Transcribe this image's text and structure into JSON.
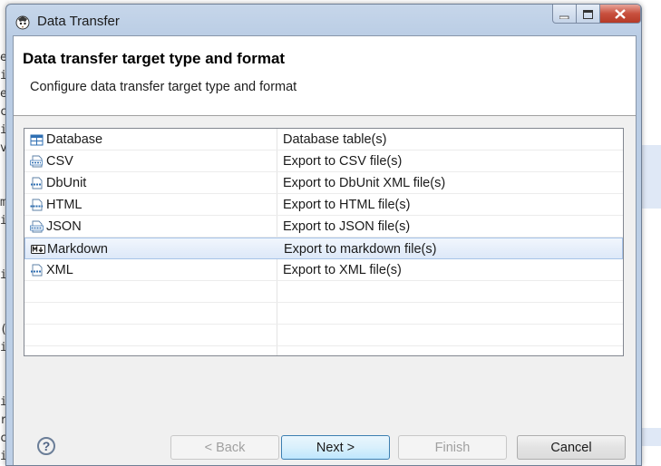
{
  "window": {
    "title": "Data Transfer"
  },
  "header": {
    "title": "Data transfer target type and format",
    "subtitle": "Configure data transfer target type and format"
  },
  "table": {
    "rows": [
      {
        "name": "Database",
        "description": "Database table(s)",
        "icon": "database-table-icon",
        "selected": false
      },
      {
        "name": "CSV",
        "description": "Export to CSV file(s)",
        "icon": "csv-file-icon",
        "selected": false
      },
      {
        "name": "DbUnit",
        "description": "Export to DbUnit XML file(s)",
        "icon": "xml-file-icon",
        "selected": false
      },
      {
        "name": "HTML",
        "description": "Export to HTML file(s)",
        "icon": "html-file-icon",
        "selected": false
      },
      {
        "name": "JSON",
        "description": "Export to JSON file(s)",
        "icon": "json-file-icon",
        "selected": false
      },
      {
        "name": "Markdown",
        "description": "Export to markdown file(s)",
        "icon": "markdown-icon",
        "selected": true
      },
      {
        "name": "XML",
        "description": "Export to XML file(s)",
        "icon": "xml-file-icon",
        "selected": false
      }
    ]
  },
  "footer": {
    "help_label": "?",
    "back_label": "< Back",
    "next_label": "Next >",
    "finish_label": "Finish",
    "cancel_label": "Cancel"
  },
  "colors": {
    "selection_border": "#a7c3e8",
    "default_button_border": "#3c7fb1",
    "close_button": "#c8503e"
  }
}
